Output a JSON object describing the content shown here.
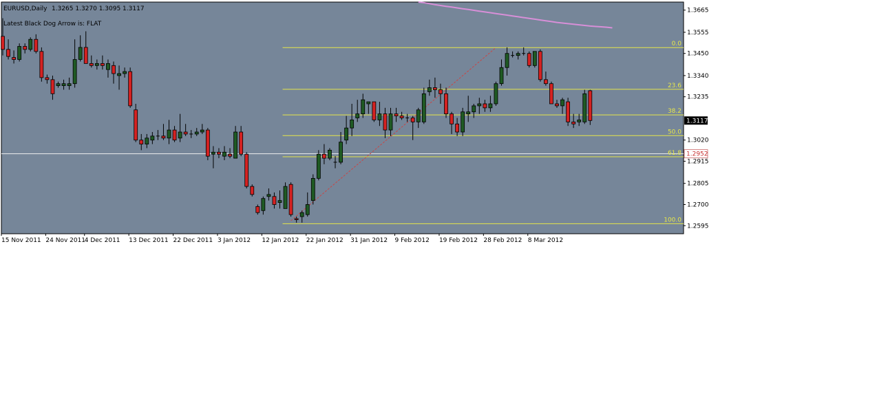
{
  "header": {
    "symbol": "EURUSD,Daily",
    "ohlc": "1.3265 1.3270 1.3095 1.3117",
    "indicator": "Latest Black Dog Arrow is:  FLAT"
  },
  "colors": {
    "background": "#768699",
    "bull_candle": "#1f5a24",
    "bear_candle": "#d42222",
    "wick": "#000000",
    "fib_line": "#e6e64a",
    "fib_text": "#e8e84a",
    "hline": "#f0f0f0",
    "moving_average": "#d88fd8",
    "trend_line": "#c84646",
    "current_price_tag": "#000000",
    "hline_price_tag": "#ffffff"
  },
  "chart_data": {
    "type": "candlestick",
    "instrument": "EURUSD",
    "timeframe": "Daily",
    "ylim": [
      1.2555,
      1.3705
    ],
    "y_ticks": [
      "1.3665",
      "1.3555",
      "1.3450",
      "1.3340",
      "1.3235",
      "1.3020",
      "1.2915",
      "1.2805",
      "1.2700",
      "1.2595"
    ],
    "x_ticks": [
      "15 Nov 2011",
      "24 Nov 2011",
      "4 Dec 2011",
      "13 Dec 2011",
      "22 Dec 2011",
      "3 Jan 2012",
      "12 Jan 2012",
      "22 Jan 2012",
      "31 Jan 2012",
      "9 Feb 2012",
      "19 Feb 2012",
      "28 Feb 2012",
      "8 Mar 2012"
    ],
    "x_tick_index": [
      0,
      8,
      15,
      23,
      31,
      39,
      47,
      55,
      63,
      71,
      79,
      87,
      95
    ],
    "current_price": "1.3117",
    "candles": [
      [
        1.3535,
        1.3625,
        1.344,
        1.347
      ],
      [
        1.347,
        1.352,
        1.342,
        1.3435
      ],
      [
        1.343,
        1.3465,
        1.34,
        1.342
      ],
      [
        1.342,
        1.35,
        1.341,
        1.3485
      ],
      [
        1.3485,
        1.35,
        1.345,
        1.347
      ],
      [
        1.347,
        1.353,
        1.346,
        1.352
      ],
      [
        1.352,
        1.3545,
        1.345,
        1.346
      ],
      [
        1.346,
        1.348,
        1.331,
        1.333
      ],
      [
        1.333,
        1.3345,
        1.33,
        1.332
      ],
      [
        1.332,
        1.334,
        1.322,
        1.325
      ],
      [
        1.329,
        1.331,
        1.328,
        1.33
      ],
      [
        1.329,
        1.332,
        1.327,
        1.33
      ],
      [
        1.329,
        1.333,
        1.327,
        1.33
      ],
      [
        1.33,
        1.352,
        1.328,
        1.342
      ],
      [
        1.342,
        1.354,
        1.341,
        1.348
      ],
      [
        1.348,
        1.356,
        1.346,
        1.34
      ],
      [
        1.34,
        1.344,
        1.338,
        1.339
      ],
      [
        1.339,
        1.342,
        1.337,
        1.34
      ],
      [
        1.34,
        1.344,
        1.337,
        1.339
      ],
      [
        1.337,
        1.342,
        1.333,
        1.34
      ],
      [
        1.339,
        1.341,
        1.33,
        1.335
      ],
      [
        1.334,
        1.339,
        1.327,
        1.335
      ],
      [
        1.335,
        1.338,
        1.333,
        1.336
      ],
      [
        1.336,
        1.338,
        1.318,
        1.319
      ],
      [
        1.317,
        1.32,
        1.301,
        1.302
      ],
      [
        1.302,
        1.305,
        1.297,
        1.3
      ],
      [
        1.3,
        1.305,
        1.298,
        1.303
      ],
      [
        1.302,
        1.306,
        1.3,
        1.304
      ],
      [
        1.304,
        1.307,
        1.302,
        1.304
      ],
      [
        1.304,
        1.31,
        1.302,
        1.303
      ],
      [
        1.303,
        1.312,
        1.3,
        1.307
      ],
      [
        1.307,
        1.309,
        1.301,
        1.302
      ],
      [
        1.303,
        1.315,
        1.301,
        1.306
      ],
      [
        1.306,
        1.31,
        1.304,
        1.305
      ],
      [
        1.305,
        1.307,
        1.303,
        1.305
      ],
      [
        1.305,
        1.308,
        1.304,
        1.306
      ],
      [
        1.306,
        1.31,
        1.305,
        1.307
      ],
      [
        1.307,
        1.308,
        1.292,
        1.294
      ],
      [
        1.295,
        1.299,
        1.288,
        1.296
      ],
      [
        1.296,
        1.298,
        1.293,
        1.295
      ],
      [
        1.294,
        1.299,
        1.292,
        1.296
      ],
      [
        1.295,
        1.298,
        1.293,
        1.294
      ],
      [
        1.293,
        1.309,
        1.293,
        1.306
      ],
      [
        1.306,
        1.309,
        1.294,
        1.295
      ],
      [
        1.295,
        1.296,
        1.278,
        1.279
      ],
      [
        1.279,
        1.28,
        1.274,
        1.275
      ],
      [
        1.269,
        1.27,
        1.265,
        1.266
      ],
      [
        1.267,
        1.274,
        1.265,
        1.273
      ],
      [
        1.274,
        1.278,
        1.272,
        1.275
      ],
      [
        1.274,
        1.276,
        1.268,
        1.27
      ],
      [
        1.271,
        1.277,
        1.268,
        1.272
      ],
      [
        1.268,
        1.281,
        1.268,
        1.279
      ],
      [
        1.28,
        1.281,
        1.264,
        1.265
      ],
      [
        1.263,
        1.264,
        1.261,
        1.2625
      ],
      [
        1.264,
        1.267,
        1.261,
        1.266
      ],
      [
        1.265,
        1.276,
        1.264,
        1.27
      ],
      [
        1.272,
        1.285,
        1.27,
        1.283
      ],
      [
        1.283,
        1.297,
        1.282,
        1.295
      ],
      [
        1.295,
        1.3,
        1.29,
        1.293
      ],
      [
        1.293,
        1.298,
        1.292,
        1.297
      ],
      [
        1.291,
        1.294,
        1.288,
        1.291
      ],
      [
        1.291,
        1.306,
        1.29,
        1.301
      ],
      [
        1.302,
        1.314,
        1.3,
        1.308
      ],
      [
        1.308,
        1.32,
        1.304,
        1.312
      ],
      [
        1.313,
        1.322,
        1.311,
        1.315
      ],
      [
        1.315,
        1.325,
        1.313,
        1.322
      ],
      [
        1.32,
        1.321,
        1.315,
        1.321
      ],
      [
        1.321,
        1.321,
        1.311,
        1.312
      ],
      [
        1.312,
        1.321,
        1.309,
        1.315
      ],
      [
        1.315,
        1.318,
        1.303,
        1.307
      ],
      [
        1.307,
        1.318,
        1.304,
        1.315
      ],
      [
        1.315,
        1.318,
        1.311,
        1.314
      ],
      [
        1.314,
        1.316,
        1.312,
        1.313
      ],
      [
        1.313,
        1.315,
        1.311,
        1.313
      ],
      [
        1.313,
        1.314,
        1.302,
        1.311
      ],
      [
        1.311,
        1.318,
        1.308,
        1.317
      ],
      [
        1.311,
        1.328,
        1.31,
        1.325
      ],
      [
        1.326,
        1.332,
        1.324,
        1.328
      ],
      [
        1.328,
        1.333,
        1.323,
        1.327
      ],
      [
        1.327,
        1.33,
        1.32,
        1.325
      ],
      [
        1.325,
        1.328,
        1.313,
        1.315
      ],
      [
        1.315,
        1.316,
        1.305,
        1.31
      ],
      [
        1.31,
        1.313,
        1.304,
        1.306
      ],
      [
        1.306,
        1.318,
        1.304,
        1.316
      ],
      [
        1.315,
        1.324,
        1.311,
        1.316
      ],
      [
        1.316,
        1.32,
        1.313,
        1.319
      ],
      [
        1.319,
        1.323,
        1.315,
        1.32
      ],
      [
        1.32,
        1.322,
        1.316,
        1.318
      ],
      [
        1.318,
        1.324,
        1.316,
        1.32
      ],
      [
        1.32,
        1.331,
        1.319,
        1.33
      ],
      [
        1.33,
        1.342,
        1.329,
        1.338
      ],
      [
        1.338,
        1.348,
        1.334,
        1.345
      ],
      [
        1.344,
        1.346,
        1.343,
        1.344
      ],
      [
        1.344,
        1.346,
        1.342,
        1.345
      ],
      [
        1.345,
        1.348,
        1.344,
        1.345
      ],
      [
        1.345,
        1.346,
        1.338,
        1.339
      ],
      [
        1.339,
        1.346,
        1.338,
        1.346
      ],
      [
        1.346,
        1.347,
        1.331,
        1.332
      ],
      [
        1.332,
        1.336,
        1.329,
        1.33
      ],
      [
        1.33,
        1.331,
        1.32,
        1.32
      ],
      [
        1.32,
        1.322,
        1.318,
        1.319
      ],
      [
        1.319,
        1.323,
        1.315,
        1.322
      ],
      [
        1.321,
        1.323,
        1.309,
        1.311
      ],
      [
        1.311,
        1.315,
        1.308,
        1.31
      ],
      [
        1.311,
        1.315,
        1.309,
        1.312
      ],
      [
        1.311,
        1.327,
        1.31,
        1.325
      ],
      [
        1.3265,
        1.327,
        1.3095,
        1.3117
      ]
    ],
    "moving_average": {
      "start_index": 75,
      "values": [
        1.3708,
        1.3702,
        1.3697,
        1.3692,
        1.3688,
        1.3684,
        1.368,
        1.3676,
        1.3672,
        1.3668,
        1.3664,
        1.366,
        1.3656,
        1.3652,
        1.3648,
        1.3644,
        1.364,
        1.3636,
        1.3632,
        1.3628,
        1.3624,
        1.362,
        1.3616,
        1.3612,
        1.3608,
        1.3604,
        1.3601,
        1.3598,
        1.3595,
        1.3592,
        1.3589,
        1.3586,
        1.3584,
        1.3582,
        1.358,
        1.3577
      ]
    },
    "fibonacci": {
      "start_index": 51,
      "levels": [
        {
          "label": "0.0",
          "price": 1.3479
        },
        {
          "label": "23.6",
          "price": 1.3272
        },
        {
          "label": "38.2",
          "price": 1.3145
        },
        {
          "label": "50.0",
          "price": 1.3042
        },
        {
          "label": "61.8",
          "price": 1.2937
        },
        {
          "label": "100.0",
          "price": 1.2605
        }
      ],
      "trend_line": {
        "from": [
          52,
          1.262
        ],
        "to": [
          89,
          1.3479
        ]
      }
    },
    "hline": {
      "price": 1.2952,
      "label": "1.2952"
    }
  }
}
